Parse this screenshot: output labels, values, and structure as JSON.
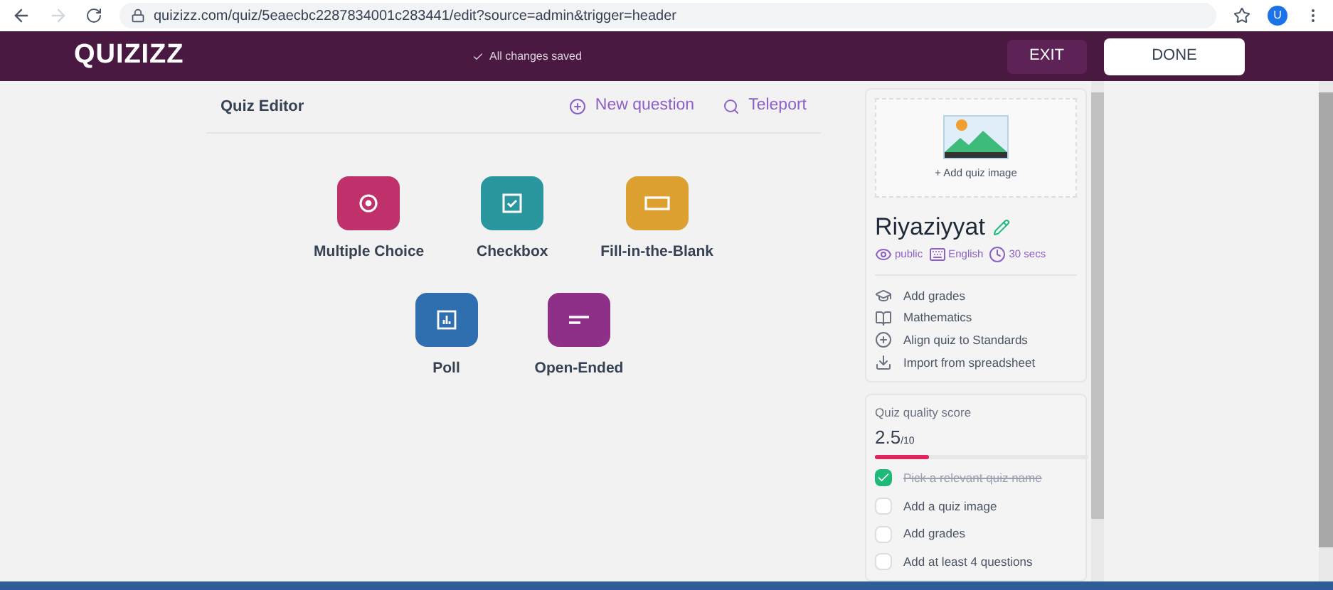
{
  "browser": {
    "url": "quizizz.com/quiz/5eaecbc2287834001c283441/edit?source=admin&trigger=header",
    "avatar": "U"
  },
  "header": {
    "logo": "QUIZIZZ",
    "save_status": "All changes saved",
    "buttons": [
      "EXIT",
      "DONE"
    ]
  },
  "editor": {
    "title": "Quiz Editor",
    "actions": [
      {
        "kind": "plus",
        "label": "New question"
      },
      {
        "kind": "search",
        "label": "Teleport"
      }
    ],
    "question_types": [
      [
        {
          "kind": "radio",
          "label": "Multiple Choice",
          "color": "#c0306a"
        },
        {
          "kind": "checkbox",
          "label": "Checkbox",
          "color": "#2a979e"
        },
        {
          "kind": "blank",
          "label": "Fill-in-the-Blank",
          "color": "#dca030"
        }
      ],
      [
        {
          "kind": "poll",
          "label": "Poll",
          "color": "#2f6fb0"
        },
        {
          "kind": "open",
          "label": "Open-Ended",
          "color": "#8e2f88"
        }
      ]
    ]
  },
  "quiz": {
    "add_image": "+ Add quiz image",
    "name": "Riyaziyyat",
    "meta": [
      {
        "kind": "eye",
        "label": "public"
      },
      {
        "kind": "lang",
        "label": "English"
      },
      {
        "kind": "clock",
        "label": "30 secs"
      }
    ],
    "details": [
      {
        "kind": "grad",
        "label": "Add grades"
      },
      {
        "kind": "book",
        "label": "Mathematics"
      },
      {
        "kind": "plus",
        "label": "Align quiz to Standards"
      },
      {
        "kind": "import",
        "label": "Import from spreadsheet"
      }
    ]
  },
  "quality": {
    "title": "Quiz quality score",
    "score": "2.5",
    "max": "/10",
    "level": 0.25,
    "checklist": [
      {
        "label": "Pick a relevant quiz name",
        "checked": true
      },
      {
        "label": "Add a quiz image",
        "checked": false
      },
      {
        "label": "Add grades",
        "checked": false
      },
      {
        "label": "Add at least 4 questions",
        "checked": false
      }
    ]
  }
}
